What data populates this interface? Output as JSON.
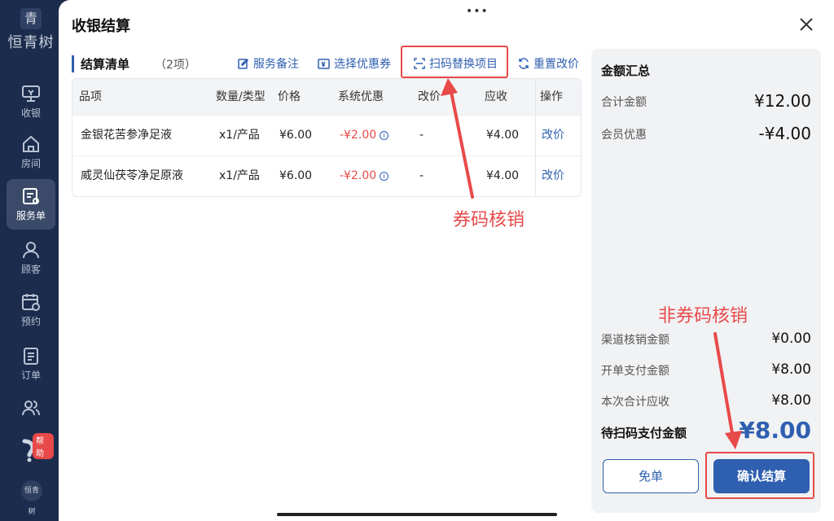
{
  "sidebar": {
    "logo_mark": "青",
    "logo_name": "恒青树",
    "items": [
      {
        "label": "收银",
        "icon": "cashier-icon"
      },
      {
        "label": "房间",
        "icon": "home-icon"
      },
      {
        "label": "服务单",
        "icon": "service-order-icon"
      },
      {
        "label": "顾客",
        "icon": "customer-icon"
      },
      {
        "label": "预约",
        "icon": "calendar-icon"
      },
      {
        "label": "订单",
        "icon": "order-icon"
      },
      {
        "label": "",
        "icon": "users-icon"
      }
    ],
    "active_item": "服务单",
    "help_badge": "帮助",
    "bottom_logo": "恒青树"
  },
  "header": {
    "handle": "•••",
    "title": "收银结算",
    "close_icon": "close-icon"
  },
  "list": {
    "title": "结算清单",
    "count": "（2项）",
    "actions": {
      "note": "服务备注",
      "coupon": "选择优惠券",
      "scan": "扫码替换项目",
      "reset": "重置改价"
    },
    "columns": [
      "品项",
      "数量/类型",
      "价格",
      "系统优惠",
      "改价",
      "应收",
      "操作"
    ],
    "rows": [
      {
        "item": "金银花苦参净足液",
        "qty": "x1/产品",
        "price": "¥6.00",
        "discount": "-¥2.00",
        "change": "-",
        "due": "¥4.00",
        "op": "改价"
      },
      {
        "item": "威灵仙茯苓净足原液",
        "qty": "x1/产品",
        "price": "¥6.00",
        "discount": "-¥2.00",
        "change": "-",
        "due": "¥4.00",
        "op": "改价"
      }
    ]
  },
  "summary": {
    "title": "金额汇总",
    "total_label": "合计金额",
    "total_value": "¥12.00",
    "member_label": "会员优惠",
    "member_value": "-¥4.00",
    "channel_label": "渠道核销金额",
    "channel_value": "¥0.00",
    "opened_label": "开单支付金额",
    "opened_value": "¥8.00",
    "current_label": "本次合计应收",
    "current_value": "¥8.00",
    "pending_label": "待扫码支付金额",
    "pending_value": "¥8.00",
    "free_button": "免单",
    "confirm_button": "确认结算"
  },
  "annotations": {
    "coupon_code": "券码核销",
    "non_coupon_code": "非券码核销",
    "color": "#e84a4a"
  },
  "colors": {
    "accent": "#2f5fb0",
    "sidebar": "#1b2c4d",
    "negative": "#e84a4a"
  }
}
